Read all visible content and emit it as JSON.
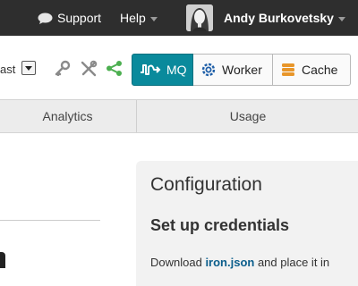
{
  "topbar": {
    "support_label": "Support",
    "help_label": "Help",
    "user_name": "Andy Burkovetsky",
    "support_icon": "chat-bubble-icon"
  },
  "toolbar": {
    "select_value": "ast",
    "tools": [
      "key-icon",
      "wrench-screwdriver-icon",
      "share-icon"
    ],
    "segments": [
      {
        "label": "MQ",
        "icon": "mq-wave-icon",
        "active": true
      },
      {
        "label": "Worker",
        "icon": "gear-icon",
        "active": false
      },
      {
        "label": "Cache",
        "icon": "database-stack-icon",
        "active": false
      }
    ],
    "accent_color": "#0a8a9c"
  },
  "tabs": [
    {
      "label": "Analytics"
    },
    {
      "label": "Usage"
    }
  ],
  "panel": {
    "title": "Configuration",
    "subtitle": "Set up credentials",
    "text_before": "Download ",
    "link_text": "iron.json",
    "text_after": " and place it in"
  }
}
